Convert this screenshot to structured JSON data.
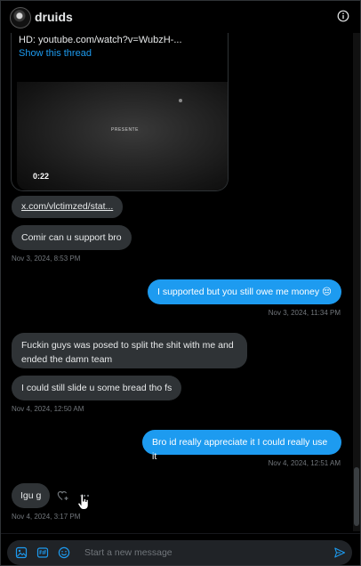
{
  "header": {
    "title": "druids",
    "info_icon": "info-icon"
  },
  "shared_card": {
    "text": "HD: youtube.com/watch?v=WubzH-...",
    "link": "Show this thread",
    "video_overlay_text": "PRESENTE",
    "duration": "0:22"
  },
  "messages": [
    {
      "side": "left",
      "text": "x.com/vlctimzed/stat..."
    },
    {
      "side": "left",
      "text": "Comir can u support bro"
    },
    {
      "timestamp": "Nov 3, 2024, 8:53 PM"
    },
    {
      "side": "right",
      "text": "I supported but you still owe me money 😔"
    },
    {
      "timestamp": "Nov 3, 2024, 11:34 PM"
    },
    {
      "side": "left",
      "text": "Fuckin guys was posed to split the shit with me and ended the damn team"
    },
    {
      "side": "left",
      "text": "I could still slide u some bread tho fs"
    },
    {
      "timestamp": "Nov 4, 2024, 12:50 AM"
    },
    {
      "side": "right",
      "text": "Bro id really appreciate it I could really use it"
    },
    {
      "timestamp": "Nov 4, 2024, 12:51 AM"
    },
    {
      "side": "left",
      "text": "Igu g"
    },
    {
      "timestamp": "Nov 4, 2024, 3:17 PM"
    }
  ],
  "composer": {
    "placeholder": "Start a new message",
    "icons": [
      "image-icon",
      "gif-icon",
      "emoji-icon",
      "send-icon"
    ]
  },
  "colors": {
    "accent": "#1d9bf0",
    "bubble_gray": "#2f3336",
    "background": "#000000",
    "muted": "#71767b"
  }
}
